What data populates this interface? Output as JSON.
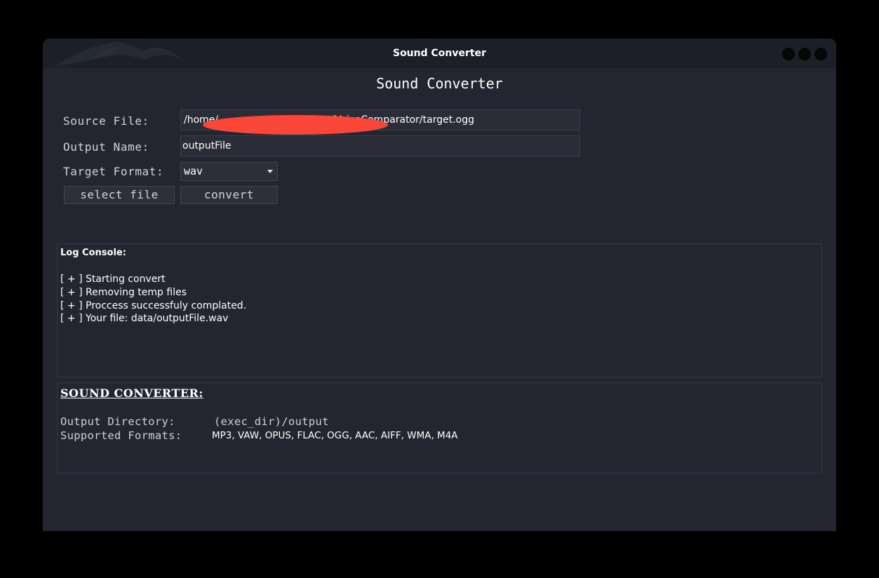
{
  "window": {
    "title": "Sound Converter"
  },
  "app": {
    "heading": "Sound Converter"
  },
  "form": {
    "source_label": "Source File:",
    "source_value": "/home/                                   t/VoiceComparator/target.ogg",
    "output_label": "Output Name:",
    "output_value": "outputFile",
    "format_label": "Target Format:",
    "format_value": "wav",
    "select_button": "select file",
    "convert_button": "convert"
  },
  "log": {
    "title": "Log Console:",
    "lines": [
      "[ + ] Starting convert",
      "[ + ] Removing temp files",
      "[ + ] Proccess successfuly complated.",
      "[ + ] Your file: data/outputFile.wav"
    ]
  },
  "info": {
    "title": "SOUND CONVERTER:",
    "output_dir_label": "Output Directory:",
    "output_dir_value": "(exec_dir)/output",
    "formats_label": "Supported Formats:",
    "formats_value": "MP3, VAW, OPUS, FLAC, OGG, AAC, AIFF, WMA, M4A"
  },
  "colors": {
    "background": "#000000",
    "window_bg": "#232630",
    "titlebar_bg": "#1c1f27",
    "field_bg": "#2a2d37",
    "redaction": "#fa4638"
  },
  "icons": {
    "titlebar_decoration": "dragon-icon",
    "window_controls": [
      "minimize-icon",
      "maximize-icon",
      "close-icon"
    ]
  }
}
